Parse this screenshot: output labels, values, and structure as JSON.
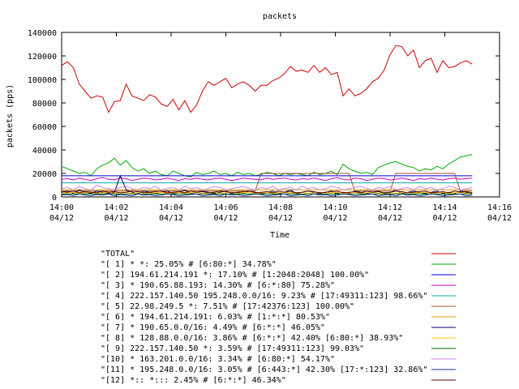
{
  "chart_data": {
    "type": "line",
    "title": "packets",
    "xlabel": "Time",
    "ylabel": "packets (pps)",
    "ylim": [
      0,
      140000
    ],
    "xlim_minutes": [
      0,
      16
    ],
    "grid": false,
    "legend_position": "bottom",
    "y_ticks": [
      "0",
      "20000",
      "40000",
      "60000",
      "80000",
      "100000",
      "120000",
      "140000"
    ],
    "x_ticks": [
      {
        "time": "14:00",
        "date": "04/12"
      },
      {
        "time": "14:02",
        "date": "04/12"
      },
      {
        "time": "14:04",
        "date": "04/12"
      },
      {
        "time": "14:06",
        "date": "04/12"
      },
      {
        "time": "14:08",
        "date": "04/12"
      },
      {
        "time": "14:10",
        "date": "04/12"
      },
      {
        "time": "14:12",
        "date": "04/12"
      },
      {
        "time": "14:14",
        "date": "04/12"
      },
      {
        "time": "14:16",
        "date": "04/12"
      }
    ],
    "series": [
      {
        "name": "\"TOTAL\"",
        "color": "#cc0000",
        "values": [
          112000,
          115000,
          110000,
          96000,
          90000,
          84000,
          86000,
          85000,
          72000,
          81000,
          82000,
          96000,
          86000,
          84000,
          82000,
          87000,
          85000,
          79000,
          77000,
          83000,
          74000,
          82000,
          72000,
          78000,
          90000,
          98000,
          95000,
          98000,
          101000,
          93000,
          96000,
          98000,
          95000,
          90000,
          95000,
          95000,
          99000,
          101000,
          105000,
          111000,
          107000,
          108000,
          106000,
          112000,
          106000,
          110000,
          104000,
          106000,
          86000,
          92000,
          86000,
          88000,
          92000,
          98000,
          101000,
          108000,
          121000,
          129000,
          128000,
          120000,
          125000,
          110000,
          116000,
          118000,
          106000,
          116000,
          110000,
          111000,
          114000,
          116000,
          113000
        ]
      },
      {
        "name": "\"[ 1] * *: 25.05% # [6:80:*] 34.78%\"",
        "color": "#00aa00",
        "values": [
          26000,
          24000,
          22000,
          20000,
          21000,
          18000,
          24000,
          27000,
          29000,
          33000,
          27000,
          31000,
          25000,
          22000,
          24000,
          20000,
          22000,
          19000,
          18000,
          22000,
          20000,
          18000,
          17000,
          21000,
          19000,
          20000,
          22000,
          19000,
          20000,
          18000,
          21000,
          19000,
          20000,
          18000,
          19000,
          21000,
          20000,
          18000,
          20000,
          19000,
          20000,
          19000,
          18000,
          21000,
          19000,
          20000,
          22000,
          19000,
          28000,
          24000,
          22000,
          20000,
          21000,
          19000,
          25000,
          27000,
          29000,
          30000,
          28000,
          26000,
          25000,
          22000,
          24000,
          23000,
          26000,
          24000,
          28000,
          31000,
          34000,
          35000,
          36000
        ]
      },
      {
        "name": "\"[ 2] 194.61.214.191 *: 17.10% # [1:2048:2048] 100.00%\"",
        "color": "#0000dd",
        "values": [
          18000,
          18000,
          18000,
          18000,
          18000,
          18000,
          18000,
          18000,
          18000,
          18000,
          18000,
          18000,
          18000,
          18000,
          18000,
          18000,
          18000,
          18000,
          18000,
          18000,
          18000,
          18000,
          18000,
          18000,
          18000,
          18000,
          18000,
          18000,
          18000,
          18000,
          18000,
          18000,
          18000,
          18000,
          18000,
          18000,
          18000,
          18000,
          18000,
          18000,
          18000,
          18000,
          18000,
          18000,
          18000,
          18000,
          18000,
          18000,
          18000,
          18000,
          18000,
          18000,
          18000,
          18000,
          18000,
          18000,
          18000,
          18000,
          18000,
          18000,
          18000,
          18000,
          18000,
          18000,
          18000,
          18000,
          18000,
          18000,
          18000,
          18000,
          18000
        ]
      },
      {
        "name": "\"[ 3] * 190.65.88.193: 14.30% # [6:*:80] 75.28%\"",
        "color": "#cc00cc",
        "values": [
          15000,
          15500,
          14500,
          16000,
          15000,
          14000,
          15500,
          16500,
          15000,
          14500,
          16000,
          15500,
          14000,
          15000,
          16000,
          15500,
          14500,
          15000,
          16000,
          15000,
          14000,
          15500,
          15000,
          16000,
          15000,
          14500,
          15500,
          16000,
          15000,
          14000,
          15000,
          16000,
          15500,
          15000,
          14500,
          16000,
          15000,
          15500,
          16000,
          15000,
          14500,
          15500,
          15000,
          16000,
          15000,
          14000,
          15500,
          16500,
          15000,
          14500,
          16000,
          15500,
          14000,
          15000,
          16000,
          15500,
          14500,
          15000,
          16000,
          15000,
          14000,
          15500,
          15000,
          16000,
          15000,
          14500,
          15500,
          16000,
          15000,
          15500,
          16000
        ]
      },
      {
        "name": "\"[ 4] 222.157.140.50 195.248.0.0/16: 9.23% # [17:49311:123] 98.66%\"",
        "color": "#00aaaa",
        "values": [
          12000,
          12000,
          12000,
          12000,
          12000,
          12000,
          12000,
          12000,
          12000,
          12000,
          12000,
          12000,
          12000,
          12000,
          12000,
          12000,
          12000,
          12000,
          12000,
          12000,
          12000,
          12000,
          12000,
          12000,
          12000,
          12000,
          12000,
          12000,
          12000,
          12000,
          12000,
          12000,
          12000,
          12000,
          12000,
          12000,
          12000,
          12000,
          12000,
          12000,
          12000,
          12000,
          12000,
          12000,
          12000,
          12000,
          12000,
          12000,
          12000,
          12000,
          12000,
          12000,
          12000,
          12000,
          12000,
          12000,
          12000,
          12000,
          12000,
          12000,
          12000,
          12000,
          12000,
          12000,
          12000,
          12000,
          12000,
          12000,
          12000,
          12000,
          12000
        ]
      },
      {
        "name": "\"[ 5] 22.98.249.5 *: 7.51% # [17:42376:123] 100.00%\"",
        "color": "#a0522d",
        "values": [
          5000,
          5000,
          5000,
          5000,
          5000,
          5000,
          5000,
          5000,
          5000,
          5000,
          5000,
          5000,
          5000,
          5000,
          5000,
          5000,
          5000,
          5000,
          5000,
          5000,
          5000,
          5000,
          5000,
          5000,
          5000,
          5000,
          5000,
          5000,
          5000,
          5000,
          5000,
          5000,
          5000,
          5000,
          20000,
          20000,
          20000,
          20000,
          20000,
          20000,
          20000,
          20000,
          20000,
          20000,
          20000,
          20000,
          20000,
          20000,
          20000,
          20000,
          5000,
          5000,
          5000,
          5000,
          5000,
          5000,
          5000,
          20000,
          20000,
          20000,
          20000,
          20000,
          20000,
          20000,
          20000,
          20000,
          20000,
          20000,
          5000,
          5000,
          5000
        ]
      },
      {
        "name": "\"[ 6] * 194.61.214.191: 6.03% # [1:*:*] 80.53%\"",
        "color": "#d4a000",
        "values": [
          6000,
          6000,
          6000,
          6000,
          6000,
          6000,
          6000,
          6000,
          6000,
          6000,
          6000,
          6000,
          6000,
          6000,
          6000,
          6000,
          6000,
          6000,
          6000,
          6000,
          6000,
          6000,
          6000,
          6000,
          6000,
          6000,
          6000,
          6000,
          6000,
          6000,
          6000,
          6000,
          6000,
          6000,
          6000,
          6000,
          6000,
          6000,
          6000,
          6000,
          6000,
          6000,
          6000,
          6000,
          6000,
          6000,
          6000,
          6000,
          6000,
          6000,
          6000,
          6000,
          6000,
          6000,
          6000,
          6000,
          6000,
          6000,
          6000,
          6000,
          6000,
          6000,
          6000,
          6000,
          6000,
          6000,
          6000,
          6000,
          6000,
          6000,
          6000
        ]
      },
      {
        "name": "\"[ 7] * 190.65.0.0/16: 4.49% # [6:*:*] 46.05%\"",
        "color": "#000066",
        "values": [
          4000,
          5000,
          3000,
          6000,
          4000,
          3000,
          5000,
          4000,
          3000,
          4000,
          18000,
          6000,
          4000,
          3000,
          5000,
          4000,
          3000,
          4000,
          5000,
          3000,
          4000,
          6000,
          3000,
          4000,
          5000,
          4000,
          3000,
          4000,
          5000,
          3000,
          4000,
          3000,
          5000,
          4000,
          3000,
          4000,
          5000,
          3000,
          4000,
          6000,
          3000,
          4000,
          5000,
          4000,
          3000,
          4000,
          5000,
          3000,
          4000,
          3000,
          5000,
          4000,
          3000,
          4000,
          5000,
          3000,
          4000,
          6000,
          3000,
          4000,
          5000,
          4000,
          3000,
          4000,
          5000,
          3000,
          4000,
          3000,
          5000,
          4000,
          3000
        ]
      },
      {
        "name": "\"[ 8] * 128.88.0.0/16: 3.86% # [6:*:*] 42.40% [6:80:*] 38.93%\"",
        "color": "#ffcc00",
        "values": [
          3000,
          3500,
          4000,
          3000,
          3500,
          4000,
          3000,
          3500,
          4000,
          3000,
          3500,
          4000,
          3000,
          3500,
          4000,
          3000,
          3500,
          4000,
          3000,
          3500,
          4000,
          3000,
          3500,
          4000,
          3000,
          3500,
          4000,
          3000,
          3500,
          4000,
          3000,
          3500,
          4000,
          3000,
          3500,
          4000,
          3000,
          3500,
          4000,
          3000,
          3500,
          4000,
          3000,
          3500,
          4000,
          3000,
          3500,
          4000,
          3000,
          3500,
          4000,
          3000,
          3500,
          4000,
          3000,
          3500,
          4000,
          3000,
          3500,
          4000,
          3000,
          3500,
          4000,
          3000,
          3500,
          4000,
          3000,
          3500,
          4000,
          3000,
          3500
        ]
      },
      {
        "name": "\"[ 9] 222.157.140.50 *: 3.59% # [17:49311:123] 99.03%\"",
        "color": "#006600",
        "values": [
          2500,
          2500,
          2500,
          2500,
          2500,
          2500,
          2500,
          2500,
          2500,
          2500,
          2500,
          2500,
          2500,
          2500,
          2500,
          2500,
          2500,
          2500,
          2500,
          2500,
          2500,
          2500,
          2500,
          2500,
          2500,
          2500,
          2500,
          2500,
          2500,
          2500,
          2500,
          2500,
          2500,
          2500,
          2500,
          2500,
          2500,
          2500,
          2500,
          2500,
          2500,
          2500,
          2500,
          2500,
          2500,
          2500,
          2500,
          2500,
          2500,
          2500,
          2500,
          2500,
          2500,
          2500,
          2500,
          2500,
          2500,
          2500,
          2500,
          2500,
          2500,
          2500,
          2500,
          2500,
          2500,
          2500,
          2500,
          2500,
          2500,
          2500,
          2500
        ]
      },
      {
        "name": "\"[10] * 163.201.0.0/16: 3.34% # [6:80:*] 54.17%\"",
        "color": "#cc88ee",
        "values": [
          7000,
          8000,
          6000,
          9000,
          7000,
          6000,
          10000,
          8000,
          7000,
          6000,
          8000,
          9000,
          7000,
          6000,
          8000,
          7000,
          9000,
          6000,
          7000,
          8000,
          6000,
          9000,
          7000,
          8000,
          6000,
          7000,
          9000,
          8000,
          6000,
          7000,
          8000,
          9000,
          7000,
          6000,
          8000,
          7000,
          9000,
          6000,
          7000,
          8000,
          6000,
          9000,
          7000,
          8000,
          6000,
          7000,
          9000,
          8000,
          6000,
          7000,
          8000,
          9000,
          7000,
          6000,
          8000,
          7000,
          9000,
          6000,
          7000,
          8000,
          6000,
          9000,
          7000,
          8000,
          6000,
          7000,
          9000,
          8000,
          6000,
          7000,
          8000
        ]
      },
      {
        "name": "\"[11] * 195.248.0.0/16: 3.05% # [6:443:*] 42.30% [17:*:123] 32.86%\"",
        "color": "#1a3399",
        "values": [
          1500,
          2000,
          1000,
          2500,
          1500,
          1000,
          2000,
          1500,
          2500,
          1000,
          2000,
          1500,
          1000,
          2500,
          1500,
          2000,
          1000,
          1500,
          2500,
          2000,
          1000,
          1500,
          2000,
          2500,
          1000,
          1500,
          2000,
          1000,
          2500,
          1500,
          2000,
          1000,
          1500,
          2500,
          2000,
          1000,
          1500,
          2000,
          2500,
          1000,
          1500,
          2000,
          1000,
          2500,
          1500,
          2000,
          1000,
          1500,
          2500,
          2000,
          1000,
          1500,
          2000,
          2500,
          1000,
          1500,
          2000,
          1000,
          2500,
          1500,
          2000,
          1000,
          1500,
          2500,
          2000,
          1000,
          1500,
          2000,
          2500,
          1000,
          1500
        ]
      },
      {
        "name": "\"[12] *:: *::: 2.45% # [6:*:*] 46.34%\"",
        "color": "#660000",
        "values": [
          4500,
          4000,
          5000,
          3500,
          4500,
          4000,
          3500,
          5000,
          4000,
          4500,
          3500,
          4000,
          5000,
          4500,
          3500,
          4000,
          4500,
          5000,
          3500,
          4000,
          4500,
          3500,
          5000,
          4000,
          4500,
          3500,
          4000,
          5000,
          4500,
          3500,
          4000,
          4500,
          5000,
          3500,
          4000,
          4500,
          3500,
          5000,
          4000,
          4500,
          3500,
          4000,
          5000,
          4500,
          3500,
          4000,
          4500,
          5000,
          3500,
          4000,
          4500,
          3500,
          5000,
          4000,
          4500,
          3500,
          4000,
          5000,
          4500,
          3500,
          4000,
          4500,
          5000,
          3500,
          4000,
          4500,
          3500,
          5000,
          4000,
          4500,
          3500
        ]
      }
    ]
  }
}
